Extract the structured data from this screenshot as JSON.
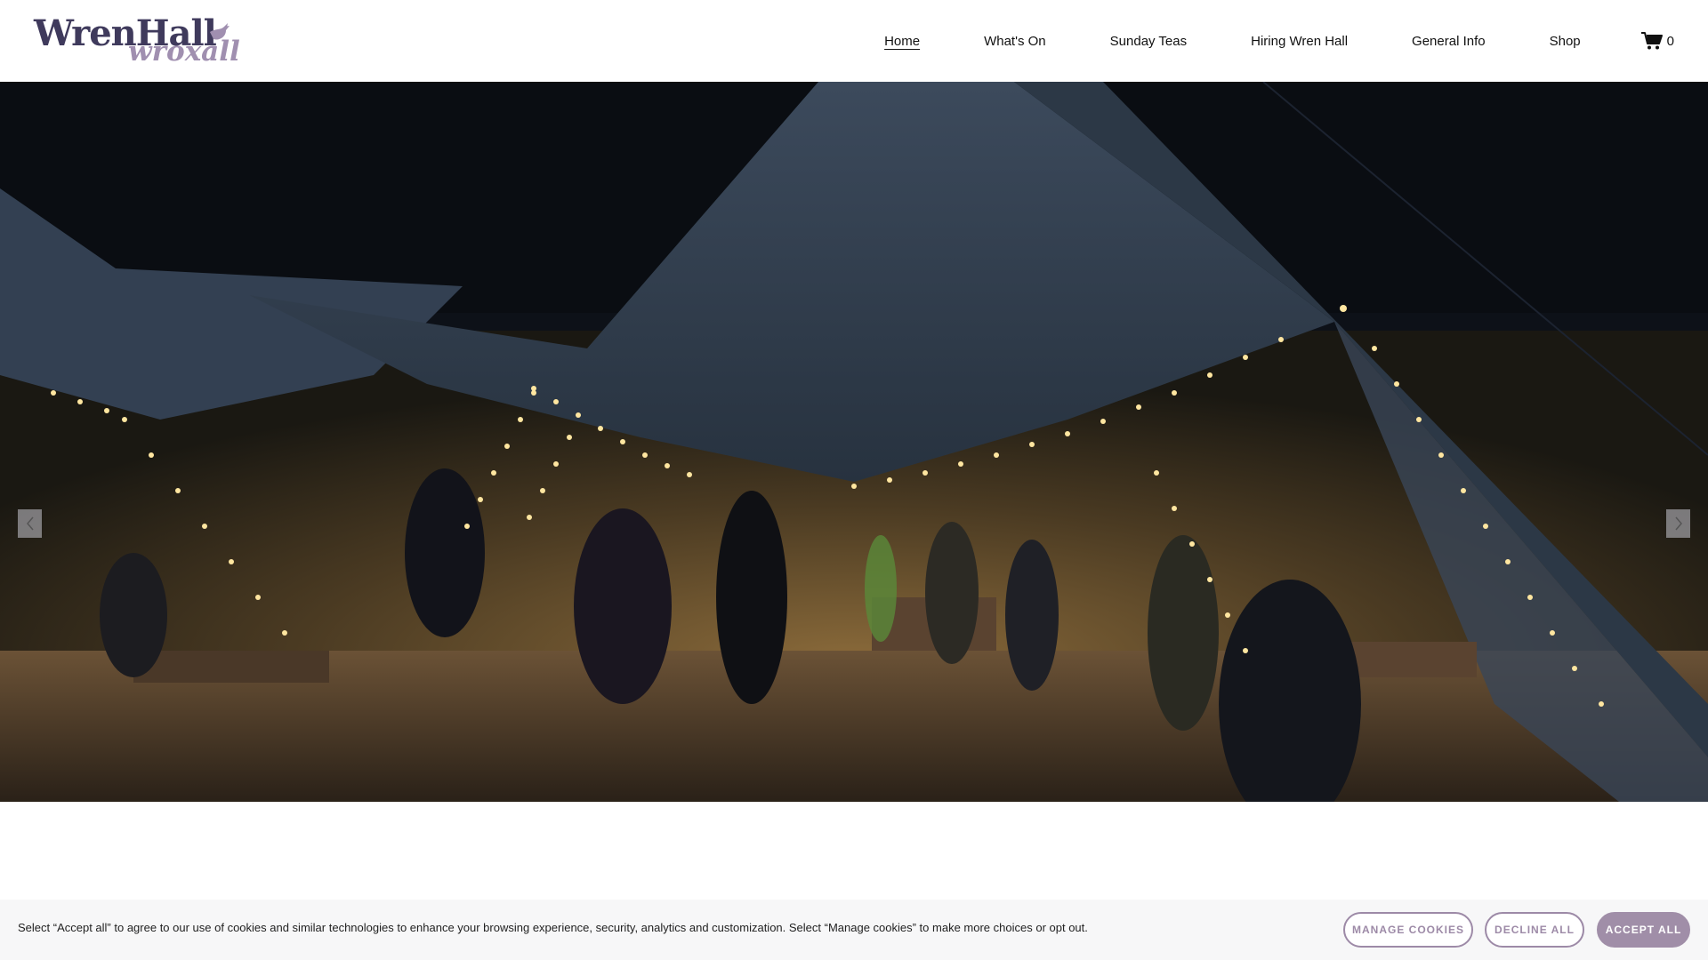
{
  "brand": {
    "name_line1": "WrenHall",
    "name_line2": "wroxall",
    "primary_color": "#3f3a5c",
    "accent_color": "#a08fb0"
  },
  "nav": {
    "items": [
      {
        "label": "Home",
        "active": true
      },
      {
        "label": "What's On",
        "active": false
      },
      {
        "label": "Sunday Teas",
        "active": false
      },
      {
        "label": "Hiring Wren Hall",
        "active": false
      },
      {
        "label": "General Info",
        "active": false
      },
      {
        "label": "Shop",
        "active": false
      }
    ],
    "cart_icon": "cart-icon",
    "cart_count": "0"
  },
  "hero": {
    "image_subject": "tipi-tents-lit-with-fairy-lights-at-night",
    "prev_icon": "chevron-left-icon",
    "next_icon": "chevron-right-icon"
  },
  "cookie_banner": {
    "text": "Select “Accept all” to agree to our use of cookies and similar technologies to enhance your browsing experience, security, analytics and customization. Select “Manage cookies” to make more choices or opt out.",
    "manage_label": "MANAGE COOKIES",
    "decline_label": "DECLINE ALL",
    "accept_label": "ACCEPT ALL",
    "button_color": "#a08ea8"
  }
}
